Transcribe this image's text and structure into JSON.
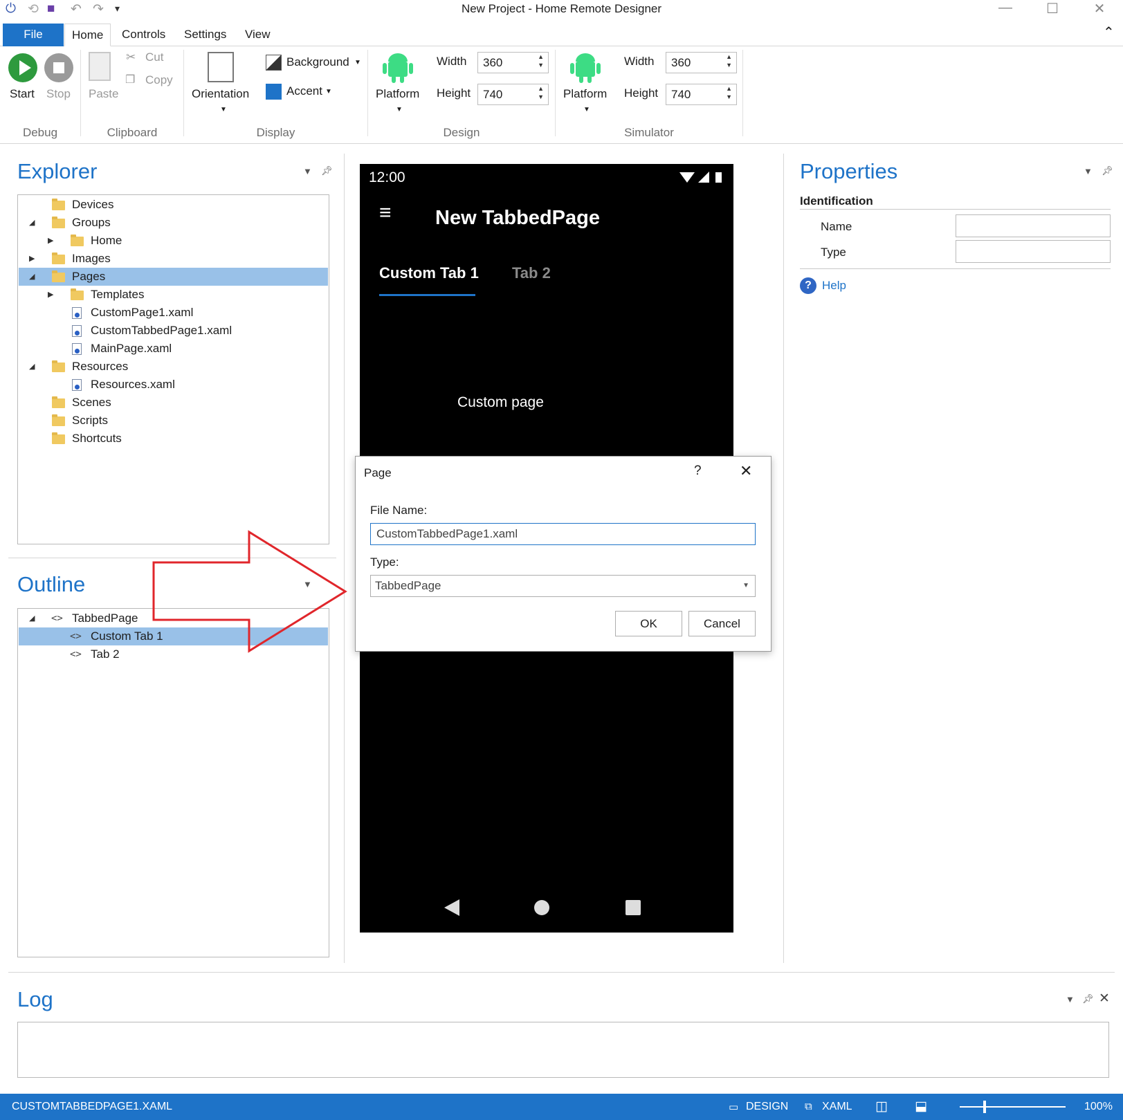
{
  "window": {
    "title": "New Project - Home Remote Designer"
  },
  "ribbon": {
    "tabs": {
      "file": "File",
      "home": "Home",
      "controls": "Controls",
      "settings": "Settings",
      "view": "View"
    },
    "debug": {
      "start": "Start",
      "stop": "Stop",
      "group": "Debug"
    },
    "clipboard": {
      "paste": "Paste",
      "cut": "Cut",
      "copy": "Copy",
      "group": "Clipboard"
    },
    "display": {
      "orientation": "Orientation",
      "background": "Background",
      "accent": "Accent",
      "group": "Display",
      "accent_color": "#1e73c8"
    },
    "design": {
      "platform": "Platform",
      "width_label": "Width",
      "width_value": "360",
      "height_label": "Height",
      "height_value": "740",
      "group": "Design"
    },
    "simulator": {
      "platform": "Platform",
      "width_label": "Width",
      "width_value": "360",
      "height_label": "Height",
      "height_value": "740",
      "group": "Simulator"
    }
  },
  "explorer": {
    "title": "Explorer",
    "items": [
      {
        "label": "Devices"
      },
      {
        "label": "Groups"
      },
      {
        "label": "Home"
      },
      {
        "label": "Images"
      },
      {
        "label": "Pages"
      },
      {
        "label": "Templates"
      },
      {
        "label": "CustomPage1.xaml"
      },
      {
        "label": "CustomTabbedPage1.xaml"
      },
      {
        "label": "MainPage.xaml"
      },
      {
        "label": "Resources"
      },
      {
        "label": "Resources.xaml"
      },
      {
        "label": "Scenes"
      },
      {
        "label": "Scripts"
      },
      {
        "label": "Shortcuts"
      }
    ]
  },
  "outline": {
    "title": "Outline",
    "items": [
      {
        "label": "TabbedPage"
      },
      {
        "label": "Custom Tab 1"
      },
      {
        "label": "Tab 2"
      }
    ]
  },
  "phone": {
    "time": "12:00",
    "page_title": "New TabbedPage",
    "tabs": [
      "Custom Tab 1",
      "Tab 2"
    ],
    "content": "Custom page"
  },
  "dialog": {
    "title": "Page",
    "help": "?",
    "file_name_label": "File Name:",
    "file_name_value": "CustomTabbedPage1.xaml",
    "type_label": "Type:",
    "type_value": "TabbedPage",
    "ok": "OK",
    "cancel": "Cancel"
  },
  "properties": {
    "title": "Properties",
    "section": "Identification",
    "name_label": "Name",
    "type_label": "Type",
    "help": "Help"
  },
  "log": {
    "title": "Log"
  },
  "status": {
    "file": "CUSTOMTABBEDPAGE1.XAML",
    "design": "DESIGN",
    "xaml": "XAML",
    "zoom": "100%"
  },
  "colors": {
    "accent": "#1e73c8",
    "selection": "#99c1e8",
    "arrow": "#e0262b",
    "android": "#3ddc84"
  }
}
